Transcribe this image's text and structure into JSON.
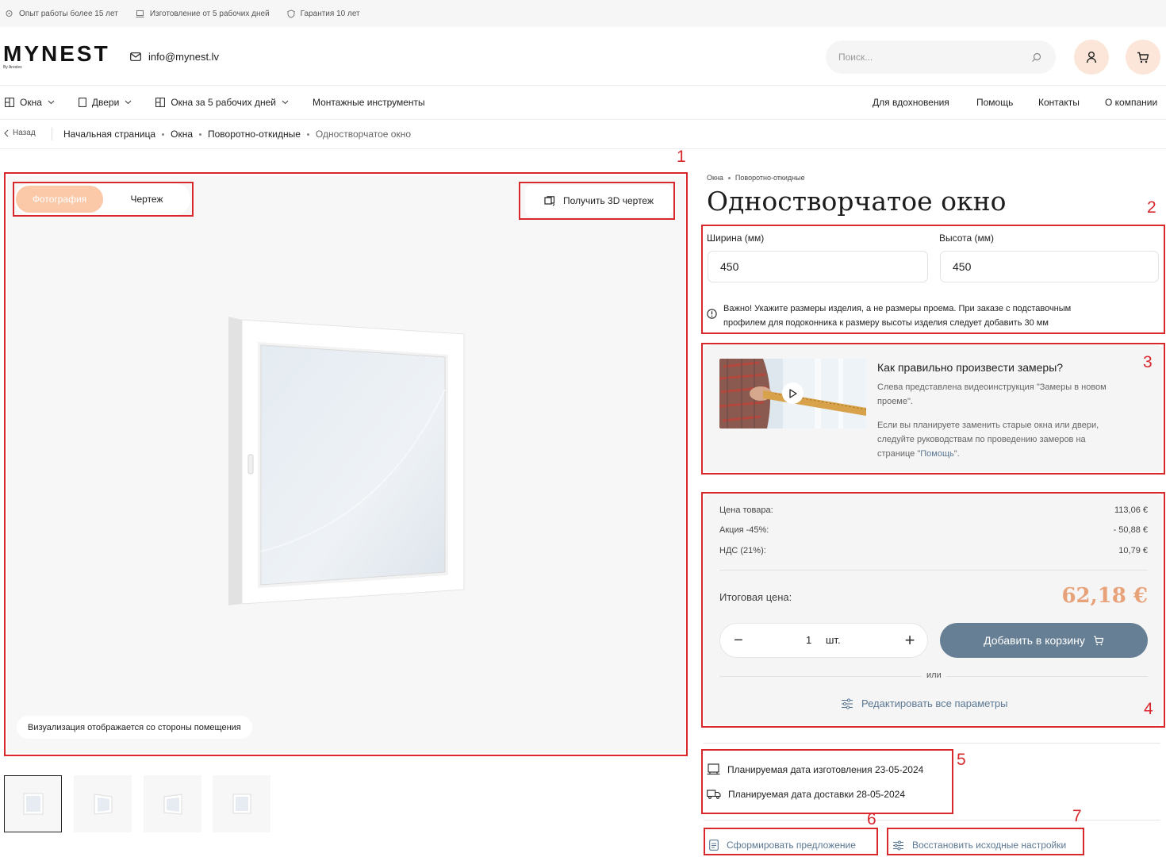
{
  "top_strip": {
    "experience": "Опыт работы более 15 лет",
    "production": "Изготовление от 5 рабочих дней",
    "warranty": "Гарантия 10 лет"
  },
  "header": {
    "logo": "MYNEST",
    "logo_sub": "By Aresles",
    "email": "info@mynest.lv",
    "search_placeholder": "Поиск..."
  },
  "nav": {
    "left": [
      "Окна",
      "Двери",
      "Окна за 5 рабочих дней",
      "Монтажные инструменты"
    ],
    "right": [
      "Для вдохновения",
      "Помощь",
      "Контакты",
      "О компании"
    ]
  },
  "breadcrumb": {
    "back": "Назад",
    "items": [
      "Начальная страница",
      "Окна",
      "Поворотно-откидные",
      "Одностворчатое окно"
    ]
  },
  "viewer": {
    "tab_photo": "Фотография",
    "tab_drawing": "Чертеж",
    "get_3d": "Получить 3D чертеж",
    "note": "Визуализация отображается со стороны помещения"
  },
  "product": {
    "crumb": [
      "Окна",
      "Поворотно-откидные"
    ],
    "title": "Одностворчатое окно",
    "width_label": "Ширина (мм)",
    "width_value": "450",
    "height_label": "Высота (мм)",
    "height_value": "450",
    "warning_line1": "Важно! Укажите размеры изделия, а не размеры проема. При заказе с подставочным",
    "warning_line2": "профилем для подоконника к размеру высоты изделия следует добавить 30 мм"
  },
  "info": {
    "title": "Как правильно произвести замеры?",
    "text1a": "Слева представлена видеоинструкция \"Замеры в новом",
    "text1b": "проеме\".",
    "text2a": "Если вы планируете заменить старые окна или двери,",
    "text2b": "следуйте руководствам по проведению замеров на",
    "text2c_pre": "странице \"",
    "text2c_link": "Помощь",
    "text2c_post": "\"."
  },
  "price": {
    "item_label": "Цена товара:",
    "item_value": "113,06 €",
    "promo_label": "Акция -45%:",
    "promo_value": "- 50,88 €",
    "vat_label": "НДС (21%):",
    "vat_value": "10,79 €",
    "total_label": "Итоговая цена:",
    "total_value": "62,18 €",
    "qty": "1",
    "unit": "шт.",
    "minus": "−",
    "plus": "+",
    "add_to_cart": "Добавить в корзину",
    "or": "или",
    "edit_params": "Редактировать все параметры"
  },
  "dates": {
    "production": "Планируемая дата изготовления 23-05-2024",
    "delivery": "Планируемая дата доставки 28-05-2024"
  },
  "actions": {
    "offer": "Сформировать предложение",
    "restore": "Восстановить исходные настройки"
  },
  "annotations": [
    "1",
    "2",
    "3",
    "4",
    "5",
    "6",
    "7"
  ],
  "colors": {
    "accent": "#fbc8a8",
    "price": "#e8a27a",
    "button": "#667f94",
    "link": "#5c7892",
    "annotation": "#d8282c"
  }
}
